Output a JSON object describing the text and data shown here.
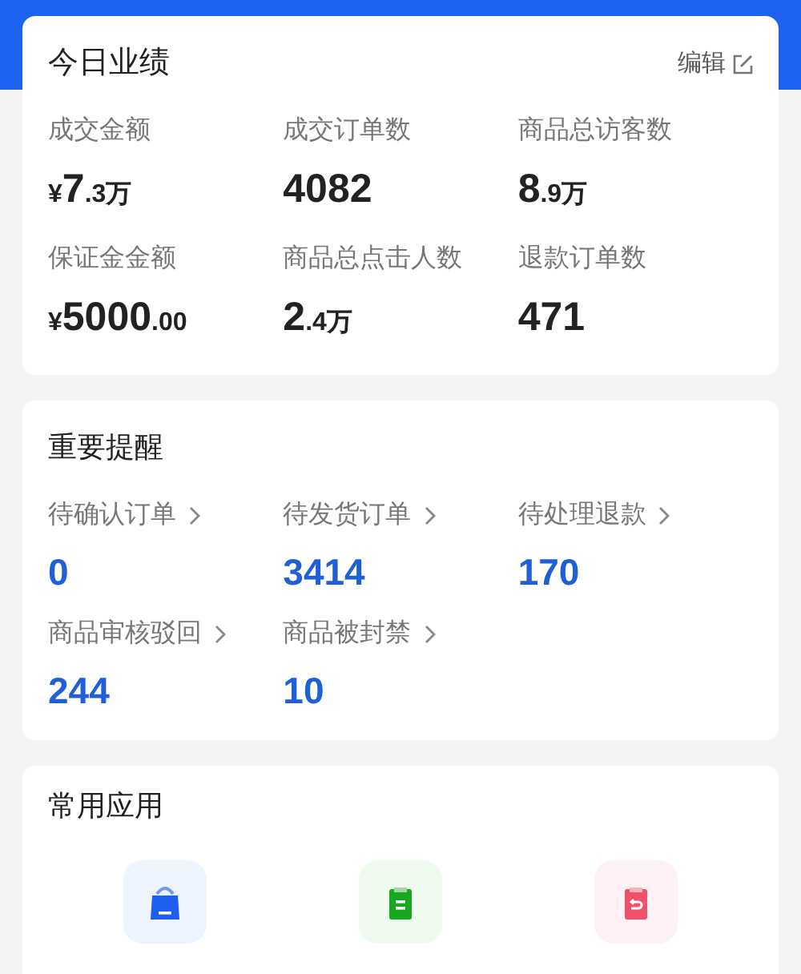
{
  "performance": {
    "title": "今日业绩",
    "edit_link": "编辑",
    "metrics": [
      {
        "label": "成交金额",
        "value": [
          {
            "kind": "small",
            "text": "¥"
          },
          {
            "kind": "big",
            "text": "7"
          },
          {
            "kind": "small",
            "text": ".3万"
          }
        ]
      },
      {
        "label": "成交订单数",
        "value": [
          {
            "kind": "big",
            "text": "4082"
          }
        ]
      },
      {
        "label": "商品总访客数",
        "value": [
          {
            "kind": "big",
            "text": "8"
          },
          {
            "kind": "small",
            "text": ".9万"
          }
        ]
      },
      {
        "label": "保证金金额",
        "value": [
          {
            "kind": "small",
            "text": "¥"
          },
          {
            "kind": "big",
            "text": "5000"
          },
          {
            "kind": "small",
            "text": ".00"
          }
        ]
      },
      {
        "label": "商品总点击人数",
        "value": [
          {
            "kind": "big",
            "text": "2"
          },
          {
            "kind": "small",
            "text": ".4万"
          }
        ]
      },
      {
        "label": "退款订单数",
        "value": [
          {
            "kind": "big",
            "text": "471"
          }
        ]
      }
    ]
  },
  "reminders": {
    "title": "重要提醒",
    "items": [
      {
        "label": "待确认订单",
        "value": "0"
      },
      {
        "label": "待发货订单",
        "value": "3414"
      },
      {
        "label": "待处理退款",
        "value": "170"
      },
      {
        "label": "商品审核驳回",
        "value": "244"
      },
      {
        "label": "商品被封禁",
        "value": "10"
      }
    ]
  },
  "apps": {
    "title": "常用应用",
    "items": [
      {
        "kind": "bag",
        "color": "#1f5ff0"
      },
      {
        "kind": "clipboard",
        "color": "#17a81f"
      },
      {
        "kind": "return",
        "color": "#f0506a"
      }
    ]
  }
}
